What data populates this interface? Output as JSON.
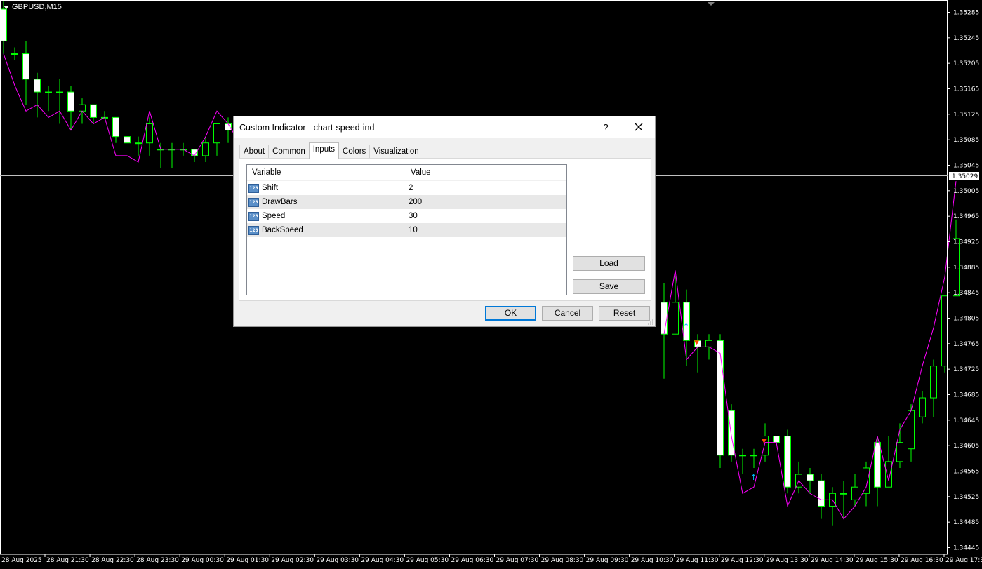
{
  "chart": {
    "symbol": "GBPUSD,M15",
    "current_price": "1.35029",
    "price_ticks": [
      "1.35285",
      "1.35245",
      "1.35205",
      "1.35165",
      "1.35125",
      "1.35085",
      "1.35045",
      "1.35005",
      "1.34965",
      "1.34925",
      "1.34885",
      "1.34845",
      "1.34805",
      "1.34765",
      "1.34725",
      "1.34685",
      "1.34645",
      "1.34605",
      "1.34565",
      "1.34525",
      "1.34485",
      "1.34445"
    ],
    "time_ticks": [
      "28 Aug 2025",
      "28 Aug 21:30",
      "28 Aug 22:30",
      "28 Aug 23:30",
      "29 Aug 00:30",
      "29 Aug 01:30",
      "29 Aug 02:30",
      "29 Aug 03:30",
      "29 Aug 04:30",
      "29 Aug 05:30",
      "29 Aug 06:30",
      "29 Aug 07:30",
      "29 Aug 08:30",
      "29 Aug 09:30",
      "29 Aug 10:30",
      "29 Aug 11:30",
      "29 Aug 12:30",
      "29 Aug 13:30",
      "29 Aug 14:30",
      "29 Aug 15:30",
      "29 Aug 16:30",
      "29 Aug 17:30"
    ],
    "colors": {
      "background": "#000000",
      "candle": "#00ff00",
      "bull_body": "#000000",
      "bear_body": "#ffffff",
      "indicator": "#ff00ff",
      "text": "#ffffff",
      "bid_line": "#c0c0c0"
    }
  },
  "chart_data": {
    "type": "candlestick",
    "symbol": "GBPUSD",
    "timeframe": "M15",
    "ylim": [
      1.34445,
      1.35305
    ],
    "left_segment": {
      "bars": [
        {
          "o": 1.3529,
          "h": 1.3531,
          "c": 1.3524,
          "l": 1.3522
        },
        {
          "o": 1.3522,
          "h": 1.3523,
          "c": 1.3522,
          "l": 1.3521
        },
        {
          "o": 1.3522,
          "h": 1.3524,
          "c": 1.3518,
          "l": 1.3514
        },
        {
          "o": 1.3518,
          "h": 1.3519,
          "c": 1.3516,
          "l": 1.3512
        },
        {
          "o": 1.3516,
          "h": 1.3517,
          "c": 1.3516,
          "l": 1.3513
        },
        {
          "o": 1.3516,
          "h": 1.3518,
          "c": 1.3516,
          "l": 1.3511
        },
        {
          "o": 1.3516,
          "h": 1.3517,
          "c": 1.3513,
          "l": 1.351
        },
        {
          "o": 1.3513,
          "h": 1.3515,
          "c": 1.3514,
          "l": 1.3511
        },
        {
          "o": 1.3514,
          "h": 1.3514,
          "c": 1.3512,
          "l": 1.3511
        },
        {
          "o": 1.3512,
          "h": 1.3513,
          "c": 1.3512,
          "l": 1.3512
        },
        {
          "o": 1.3512,
          "h": 1.3512,
          "c": 1.3509,
          "l": 1.3508
        },
        {
          "o": 1.3509,
          "h": 1.3509,
          "c": 1.3508,
          "l": 1.3508
        },
        {
          "o": 1.3508,
          "h": 1.3509,
          "c": 1.3508,
          "l": 1.3506
        },
        {
          "o": 1.3508,
          "h": 1.3512,
          "c": 1.3511,
          "l": 1.3506
        },
        {
          "o": 1.3507,
          "h": 1.3508,
          "c": 1.3507,
          "l": 1.3504
        },
        {
          "o": 1.3507,
          "h": 1.3508,
          "c": 1.3507,
          "l": 1.3504
        },
        {
          "o": 1.3507,
          "h": 1.3508,
          "c": 1.3507,
          "l": 1.3506
        },
        {
          "o": 1.3507,
          "h": 1.3507,
          "c": 1.3506,
          "l": 1.3505
        },
        {
          "o": 1.3506,
          "h": 1.3509,
          "c": 1.3508,
          "l": 1.3505
        },
        {
          "o": 1.3508,
          "h": 1.3511,
          "c": 1.3511,
          "l": 1.3506
        },
        {
          "o": 1.3511,
          "h": 1.3512,
          "c": 1.351,
          "l": 1.3508
        },
        {
          "o": 1.351,
          "h": 1.3511,
          "c": 1.3506,
          "l": 1.3505
        }
      ],
      "indicator": [
        1.3522,
        1.3517,
        1.3513,
        1.3514,
        1.3512,
        1.3513,
        1.351,
        1.3513,
        1.3511,
        1.3512,
        1.3506,
        1.3506,
        1.3505,
        1.3513,
        1.3507,
        1.3507,
        1.3507,
        1.3506,
        1.3509,
        1.3513,
        1.3511,
        1.3508
      ]
    },
    "right_segment": {
      "bars": [
        {
          "o": 1.3483,
          "h": 1.3486,
          "c": 1.3478,
          "l": 1.3471
        },
        {
          "o": 1.3478,
          "h": 1.3487,
          "c": 1.3483,
          "l": 1.3478
        },
        {
          "o": 1.3483,
          "h": 1.3485,
          "c": 1.3477,
          "l": 1.3473
        },
        {
          "o": 1.3477,
          "h": 1.3478,
          "c": 1.3476,
          "l": 1.3472
        },
        {
          "o": 1.3476,
          "h": 1.3478,
          "c": 1.3477,
          "l": 1.3474
        },
        {
          "o": 1.3477,
          "h": 1.3478,
          "c": 1.3459,
          "l": 1.3457
        },
        {
          "o": 1.3466,
          "h": 1.3467,
          "c": 1.3459,
          "l": 1.3458
        },
        {
          "o": 1.3459,
          "h": 1.346,
          "c": 1.3459,
          "l": 1.3456
        },
        {
          "o": 1.3459,
          "h": 1.346,
          "c": 1.3459,
          "l": 1.3457
        },
        {
          "o": 1.3459,
          "h": 1.3464,
          "c": 1.3462,
          "l": 1.3458
        },
        {
          "o": 1.3462,
          "h": 1.3462,
          "c": 1.3461,
          "l": 1.3461
        },
        {
          "o": 1.3462,
          "h": 1.3463,
          "c": 1.3454,
          "l": 1.3453
        },
        {
          "o": 1.3454,
          "h": 1.3458,
          "c": 1.3456,
          "l": 1.3453
        },
        {
          "o": 1.3456,
          "h": 1.3457,
          "c": 1.3455,
          "l": 1.3453
        },
        {
          "o": 1.3455,
          "h": 1.3456,
          "c": 1.3451,
          "l": 1.3449
        },
        {
          "o": 1.3451,
          "h": 1.3454,
          "c": 1.3453,
          "l": 1.3448
        },
        {
          "o": 1.3453,
          "h": 1.3455,
          "c": 1.3453,
          "l": 1.3449
        },
        {
          "o": 1.3452,
          "h": 1.3456,
          "c": 1.3454,
          "l": 1.3451
        },
        {
          "o": 1.3453,
          "h": 1.3458,
          "c": 1.3457,
          "l": 1.3451
        },
        {
          "o": 1.3461,
          "h": 1.3462,
          "c": 1.3454,
          "l": 1.3451
        },
        {
          "o": 1.3454,
          "h": 1.3462,
          "c": 1.3458,
          "l": 1.3454
        },
        {
          "o": 1.3458,
          "h": 1.3464,
          "c": 1.3461,
          "l": 1.3457
        },
        {
          "o": 1.346,
          "h": 1.3467,
          "c": 1.3466,
          "l": 1.3458
        },
        {
          "o": 1.3465,
          "h": 1.3469,
          "c": 1.3468,
          "l": 1.3464
        },
        {
          "o": 1.3468,
          "h": 1.3474,
          "c": 1.3473,
          "l": 1.3465
        },
        {
          "o": 1.3473,
          "h": 1.3484,
          "c": 1.3484,
          "l": 1.3472
        },
        {
          "o": 1.3484,
          "h": 1.3496,
          "c": 1.3493,
          "l": 1.3484
        }
      ],
      "indicator": [
        1.3478,
        1.3488,
        1.3474,
        1.3476,
        1.3476,
        1.3475,
        1.3462,
        1.3453,
        1.3454,
        1.3461,
        1.3461,
        1.3451,
        1.3455,
        1.3453,
        1.3452,
        1.3452,
        1.3449,
        1.3451,
        1.3454,
        1.3462,
        1.3455,
        1.3463,
        1.3466,
        1.3473,
        1.3479,
        1.3487,
        1.3502
      ]
    }
  },
  "dialog": {
    "title": "Custom Indicator - chart-speed-ind",
    "help": "?",
    "tabs": [
      "About",
      "Common",
      "Inputs",
      "Colors",
      "Visualization"
    ],
    "active_tab": "Inputs",
    "table": {
      "headers": [
        "Variable",
        "Value"
      ],
      "rows": [
        {
          "variable": "Shift",
          "value": "2"
        },
        {
          "variable": "DrawBars",
          "value": "200"
        },
        {
          "variable": "Speed",
          "value": "30"
        },
        {
          "variable": "BackSpeed",
          "value": "10"
        }
      ]
    },
    "buttons": {
      "load": "Load",
      "save": "Save",
      "ok": "OK",
      "cancel": "Cancel",
      "reset": "Reset"
    }
  }
}
